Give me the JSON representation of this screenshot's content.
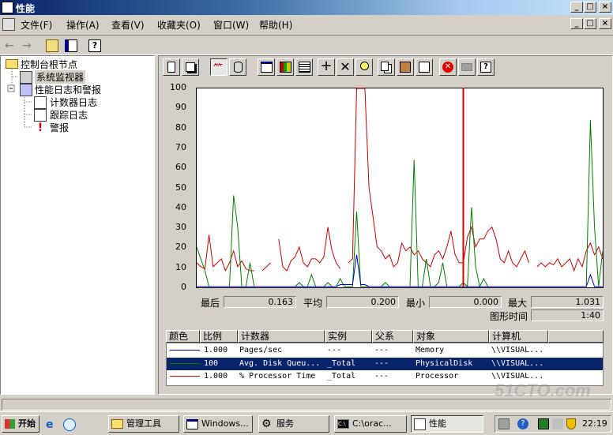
{
  "window": {
    "title": "性能"
  },
  "menu": [
    "文件(F)",
    "操作(A)",
    "查看(V)",
    "收藏夹(O)",
    "窗口(W)",
    "帮助(H)"
  ],
  "tree": {
    "root": "控制台根节点",
    "monitor": "系统监视器",
    "logs": "性能日志和警报",
    "counter_logs": "计数器日志",
    "trace_logs": "跟踪日志",
    "alerts": "警报"
  },
  "stats": {
    "last_label": "最后",
    "last": "0.163",
    "avg_label": "平均",
    "avg": "0.200",
    "min_label": "最小",
    "min": "0.000",
    "max_label": "最大",
    "max": "1.031",
    "duration_label": "图形时间",
    "duration": "1:40"
  },
  "legend_headers": [
    "颜色",
    "比例",
    "计数器",
    "实例",
    "父系",
    "对象",
    "计算机"
  ],
  "legend_rows": [
    {
      "color": "#0000cc",
      "scale": "1.000",
      "counter": "Pages/sec",
      "instance": "---",
      "parent": "---",
      "object": "Memory",
      "computer": "\\\\VISUAL..."
    },
    {
      "color": "#008000",
      "scale": "100",
      "counter": "Avg. Disk Queu...",
      "instance": "_Total",
      "parent": "---",
      "object": "PhysicalDisk",
      "computer": "\\\\VISUAL..."
    },
    {
      "color": "#cc0000",
      "scale": "1.000",
      "counter": "% Processor Time",
      "instance": "_Total",
      "parent": "---",
      "object": "Processor",
      "computer": "\\\\VISUAL..."
    }
  ],
  "chart_data": {
    "type": "line",
    "ylim": [
      0,
      100
    ],
    "yticks": [
      "100",
      "90",
      "80",
      "70",
      "60",
      "50",
      "40",
      "30",
      "20",
      "10",
      "0"
    ],
    "x_count": 100,
    "current_marker_index": 65,
    "series": [
      {
        "color": "#cc0000",
        "values": [
          12,
          10,
          9,
          26,
          10,
          12,
          14,
          8,
          12,
          18,
          10,
          13,
          9,
          8,
          8,
          null,
          8,
          10,
          12,
          null,
          24,
          10,
          8,
          13,
          15,
          20,
          12,
          10,
          14,
          14,
          12,
          15,
          30,
          18,
          12,
          9,
          null,
          12,
          14,
          100,
          100,
          100,
          50,
          35,
          20,
          18,
          14,
          16,
          10,
          12,
          22,
          18,
          20,
          16,
          18,
          14,
          12,
          10,
          16,
          18,
          14,
          20,
          28,
          16,
          12,
          12,
          25,
          30,
          20,
          24,
          24,
          28,
          30,
          24,
          14,
          12,
          18,
          12,
          10,
          14,
          18,
          12,
          null,
          10,
          12,
          10,
          12,
          11,
          14,
          10,
          12,
          14,
          8,
          14,
          10,
          18,
          22,
          16,
          20,
          14
        ]
      },
      {
        "color": "#008000",
        "values": [
          20,
          14,
          8,
          0,
          0,
          0,
          0,
          0,
          0,
          46,
          30,
          0,
          0,
          12,
          0,
          0,
          0,
          0,
          0,
          0,
          0,
          0,
          0,
          0,
          0,
          2,
          0,
          0,
          6,
          0,
          0,
          0,
          2,
          0,
          0,
          4,
          0,
          0,
          0,
          38,
          0,
          0,
          0,
          0,
          0,
          0,
          2,
          0,
          0,
          0,
          0,
          0,
          0,
          64,
          0,
          0,
          14,
          0,
          0,
          2,
          12,
          0,
          0,
          0,
          0,
          2,
          0,
          40,
          10,
          0,
          4,
          0,
          0,
          0,
          0,
          0,
          0,
          0,
          0,
          0,
          0,
          0,
          0,
          0,
          0,
          0,
          0,
          0,
          0,
          0,
          0,
          0,
          0,
          0,
          0,
          0,
          84,
          30,
          0,
          18
        ]
      },
      {
        "color": "#0000cc",
        "values": [
          0,
          0,
          0,
          0,
          0,
          0,
          0,
          0,
          0,
          0,
          0,
          0,
          0,
          0,
          0,
          0,
          0,
          0,
          0,
          0,
          0,
          0,
          0,
          0,
          0,
          0,
          0,
          0,
          0,
          0,
          0,
          0,
          0,
          0,
          0,
          1,
          1,
          1,
          1,
          16,
          1,
          1,
          0,
          0,
          0,
          0,
          0,
          0,
          0,
          0,
          0,
          0,
          0,
          0,
          0,
          0,
          0,
          0,
          0,
          0,
          0,
          0,
          0,
          0,
          0,
          0,
          0,
          0,
          0,
          0,
          0,
          0,
          0,
          0,
          0,
          0,
          0,
          0,
          0,
          0,
          0,
          0,
          0,
          0,
          0,
          0,
          0,
          0,
          0,
          0,
          0,
          0,
          0,
          0,
          0,
          0,
          6,
          0,
          0,
          0
        ]
      }
    ]
  },
  "taskbar": {
    "start": "开始",
    "tasks": [
      "管理工具",
      "Windows...",
      "服务",
      "C:\\orac...",
      "性能"
    ],
    "clock": "22:19"
  },
  "watermark": "51CTO.com"
}
